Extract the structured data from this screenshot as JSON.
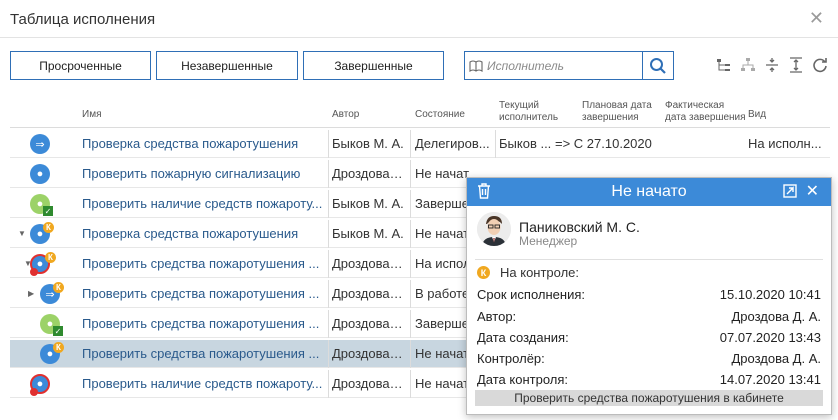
{
  "window": {
    "title": "Таблица исполнения",
    "close_glyph": "✕"
  },
  "filters": {
    "overdue": "Просроченные",
    "unfinished": "Незавершенные",
    "finished": "Завершенные"
  },
  "search": {
    "placeholder": "Исполнитель",
    "icon": "magnifier-icon"
  },
  "toolbar_icons": [
    "tree-icon",
    "hierarchy-icon",
    "collapse-icon",
    "expand-icon",
    "refresh-icon"
  ],
  "columns": {
    "name": "Имя",
    "author": "Автор",
    "state": "Состояние",
    "executor": "Текущий исполнитель",
    "planned": "Плановая дата завершения",
    "actual": "Фактическая дата завершения",
    "kind": "Вид"
  },
  "rows": [
    {
      "name": "Проверка средства пожаротушения",
      "author": "Быков М. А.",
      "state": "Делегиров...",
      "executor": "Быков ...",
      "planned": "=> С 27.10.2020",
      "kind": "На исполн..."
    },
    {
      "name": "Проверить пожарную сигнализацию",
      "author": "Дроздова ...",
      "state": "Не начат",
      "executor": "",
      "planned": "",
      "kind": ""
    },
    {
      "name": "Проверить наличие средств пожароту...",
      "author": "Быков М. А.",
      "state": "Заверше",
      "executor": "",
      "planned": "",
      "kind": ""
    },
    {
      "name": "Проверка средства пожаротушения",
      "author": "Быков М. А.",
      "state": "Не начат",
      "executor": "",
      "planned": "",
      "kind": ""
    },
    {
      "name": "Проверить средства пожаротушения ...",
      "author": "Дроздова ...",
      "state": "На испол",
      "executor": "",
      "planned": "",
      "kind": ""
    },
    {
      "name": "Проверить средства пожаротушения ...",
      "author": "Дроздова ...",
      "state": "В работе",
      "executor": "",
      "planned": "",
      "kind": ""
    },
    {
      "name": "Проверить средства пожаротушения ...",
      "author": "Дроздова ...",
      "state": "Заверше",
      "executor": "",
      "planned": "",
      "kind": ""
    },
    {
      "name": "Проверить средства пожаротушения ...",
      "author": "Дроздова ...",
      "state": "Не начат",
      "executor": "",
      "planned": "",
      "kind": ""
    },
    {
      "name": "Проверить наличие средств пожароту...",
      "author": "Дроздова ...",
      "state": "Не начат",
      "executor": "",
      "planned": "",
      "kind": ""
    }
  ],
  "popup": {
    "title": "Не начато",
    "person_name": "Паниковский М. С.",
    "person_role": "Менеджер",
    "on_control_label": "На контроле:",
    "k_badge": "К",
    "fields": [
      {
        "label": "Срок исполнения:",
        "value": "15.10.2020 10:41"
      },
      {
        "label": "Автор:",
        "value": "Дроздова Д. А."
      },
      {
        "label": "Дата создания:",
        "value": "07.07.2020 13:43"
      },
      {
        "label": "Контролёр:",
        "value": "Дроздова Д. А."
      },
      {
        "label": "Дата контроля:",
        "value": "14.07.2020 13:41"
      }
    ],
    "footer": "Проверить средства пожаротушения в кабинете"
  },
  "colors": {
    "accent": "#3c8ad8",
    "border_blue": "#2f6fb6",
    "link": "#2a5a8c",
    "selected_row": "#c8d6e0",
    "control_badge": "#f0a820",
    "done_green": "#9cd268",
    "alert_red": "#e03030"
  }
}
